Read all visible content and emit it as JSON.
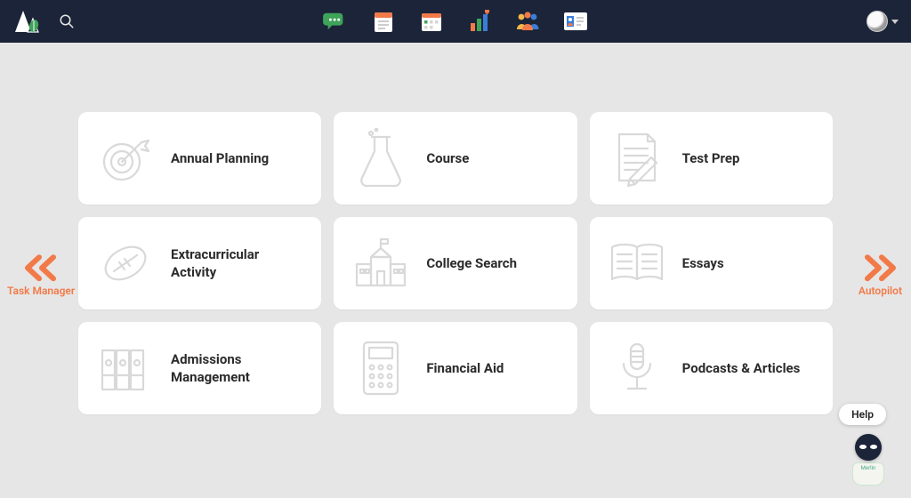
{
  "colors": {
    "accent": "#f27a49",
    "navbar": "#1b2438",
    "card_bg": "#ffffff",
    "page_bg": "#e6e6e6"
  },
  "topbar": {
    "nav_icons": [
      "chat-icon",
      "notes-icon",
      "calendar-icon",
      "stats-icon",
      "community-icon",
      "id-card-icon"
    ]
  },
  "side_nav": {
    "left_label": "Task Manager",
    "right_label": "Autopilot"
  },
  "cards": [
    {
      "label": "Annual Planning",
      "icon": "target-icon"
    },
    {
      "label": "Course",
      "icon": "flask-icon"
    },
    {
      "label": "Test Prep",
      "icon": "notepad-pencil-icon"
    },
    {
      "label": "Extracurricular Activity",
      "icon": "football-icon"
    },
    {
      "label": "College Search",
      "icon": "school-building-icon"
    },
    {
      "label": "Essays",
      "icon": "open-book-icon"
    },
    {
      "label": "Admissions Management",
      "icon": "binders-icon"
    },
    {
      "label": "Financial Aid",
      "icon": "calculator-icon"
    },
    {
      "label": "Podcasts & Articles",
      "icon": "microphone-icon"
    }
  ],
  "help": {
    "bubble": "Help",
    "bot_name": "Merlin"
  }
}
